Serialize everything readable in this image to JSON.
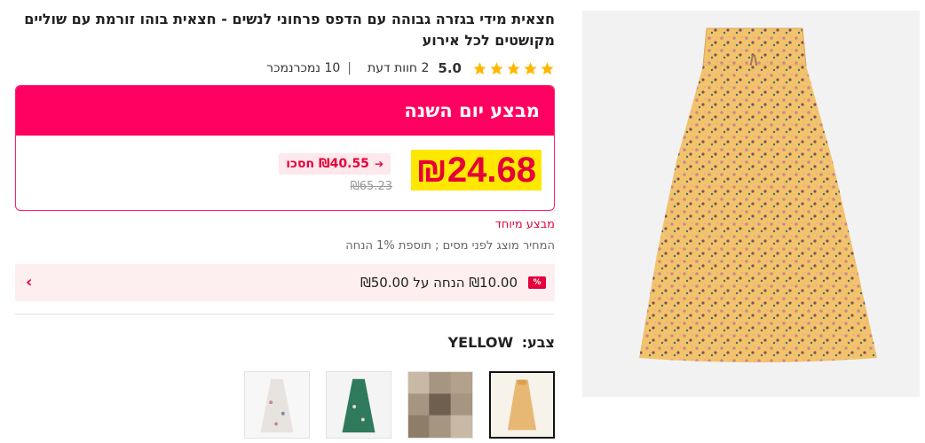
{
  "product": {
    "title": "חצאית מידי בגזרה גבוהה עם הדפס פרחוני לנשים - חצאית בוהו זורמת עם שוליים מקושטים לכל אירוע",
    "rating": "5.0",
    "reviews": "2 חוות דעת",
    "sold": "10 נמכרנמכר",
    "separator": "|"
  },
  "deal": {
    "title": "מבצע יום השנה",
    "price": "₪24.68",
    "save_amount": "₪40.55 חסכו",
    "save_arrow": "➔",
    "original_price": "₪65.23"
  },
  "special_deal": "מבצע מיוחד",
  "tax_note": "המחיר מוצג לפני מסים ; תוספת 1% הנחה",
  "coupon": {
    "tag": "%",
    "text": "₪10.00 הנחה על ₪50.00",
    "chevron": "›"
  },
  "color": {
    "label": "צבע:",
    "value": "YELLOW"
  },
  "colors": {
    "price": "#e5003a",
    "price_highlight": "#ffe800",
    "header_pink": "#ff0060",
    "star": "#ffb800"
  },
  "icons": {
    "star": "star-icon",
    "chevron": "chevron-right-icon",
    "coupon": "discount-tag-icon"
  }
}
